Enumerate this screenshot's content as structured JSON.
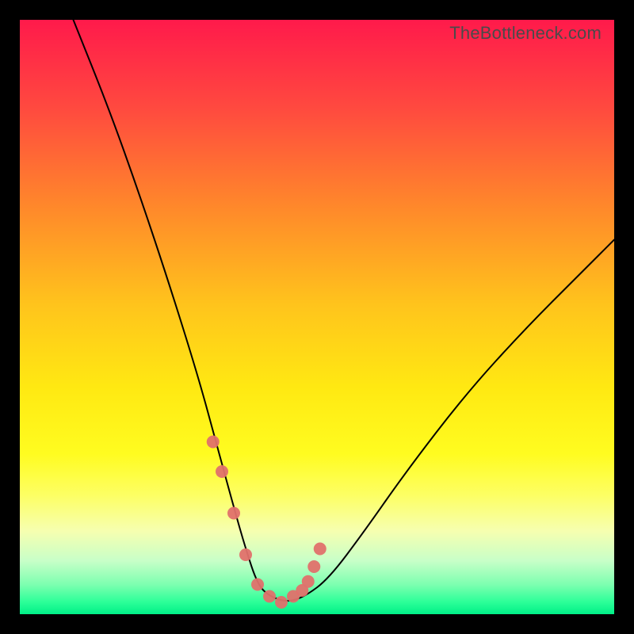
{
  "watermark": "TheBottleneck.com",
  "colors": {
    "gradient_top": "#ff1a4b",
    "gradient_bottom": "#00ef87",
    "curve": "#000000",
    "marker": "#e0716c",
    "frame_bg": "#000000"
  },
  "chart_data": {
    "type": "line",
    "title": "",
    "xlabel": "",
    "ylabel": "",
    "xlim": [
      0,
      100
    ],
    "ylim": [
      0,
      100
    ],
    "grid": false,
    "series": [
      {
        "name": "bottleneck-curve",
        "x": [
          9,
          15,
          20,
          25,
          30,
          33,
          36,
          38,
          40,
          42,
          45,
          48,
          52,
          58,
          65,
          75,
          85,
          95,
          100
        ],
        "y": [
          100,
          85,
          71,
          56,
          40,
          29,
          18,
          11,
          5,
          3,
          2,
          3,
          6,
          14,
          24,
          37,
          48,
          58,
          63
        ]
      }
    ],
    "markers": {
      "name": "highlighted-points",
      "x": [
        32.5,
        34,
        36,
        38,
        40,
        42,
        44,
        46,
        47.5,
        48.5,
        49.5,
        50.5
      ],
      "y": [
        29,
        24,
        17,
        10,
        5,
        3,
        2,
        3,
        4,
        5.5,
        8,
        11
      ]
    }
  }
}
